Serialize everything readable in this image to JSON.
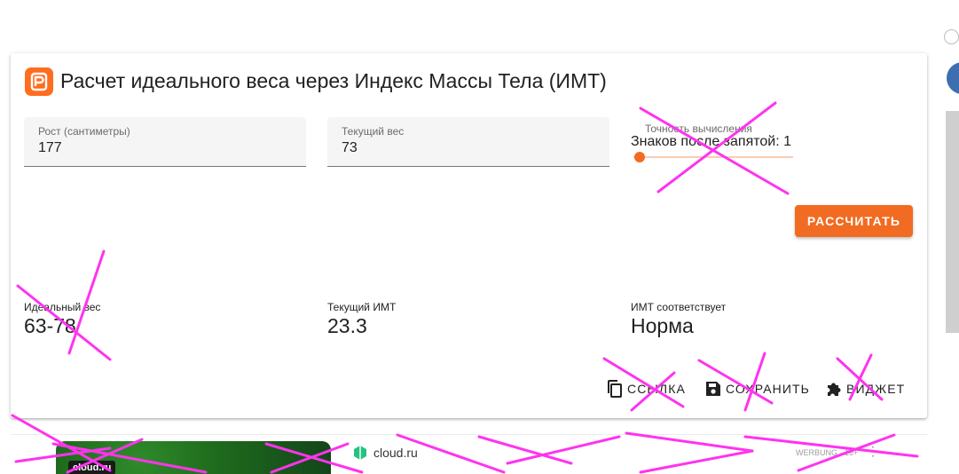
{
  "calculator": {
    "title": "Расчет идеального веса через Индекс Массы Тела (ИМТ)",
    "height_field": {
      "label": "Рост (сантиметры)",
      "value": "177"
    },
    "weight_field": {
      "label": "Текущий вес",
      "value": "73"
    },
    "precision": {
      "label": "Точность вычисления",
      "value_text": "Знаков после запятой: 1",
      "level": 1
    },
    "calculate_label": "РАССЧИТАТЬ",
    "results": [
      {
        "label": "Идеальный вес",
        "value": "63-78"
      },
      {
        "label": "Текущий ИМТ",
        "value": "23.3"
      },
      {
        "label": "ИМТ соответствует",
        "value": "Норма"
      }
    ],
    "actions": {
      "link": "ССЫЛКА",
      "save": "СОХРАНИТЬ",
      "widget": "ВИДЖЕТ"
    }
  },
  "ad": {
    "image_label": "cloud.ru",
    "brand": "cloud.ru",
    "meta": "WERBUNG · 16+"
  },
  "colors": {
    "accent": "#f26b22",
    "logo": "#ff6d1f",
    "annotation": "#ff33ee"
  },
  "icons": [
    "logo-icon",
    "copy-icon",
    "save-icon",
    "puzzle-icon",
    "cloud-icon",
    "more-icon"
  ]
}
